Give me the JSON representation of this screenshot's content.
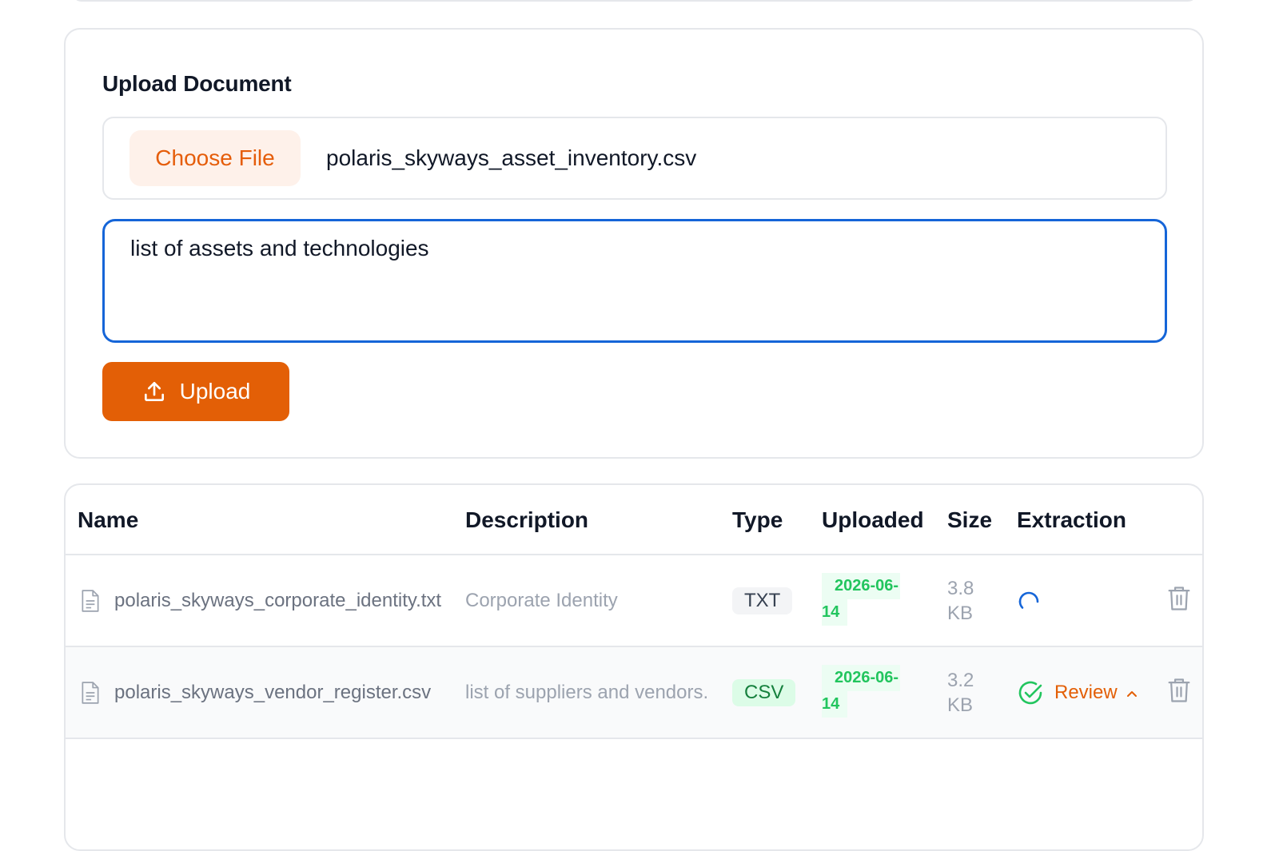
{
  "upload": {
    "title": "Upload Document",
    "choose_file_label": "Choose File",
    "selected_file": "polaris_skyways_asset_inventory.csv",
    "description_value": "list of assets and technologies",
    "upload_label": "Upload"
  },
  "table": {
    "headers": {
      "name": "Name",
      "description": "Description",
      "type": "Type",
      "uploaded": "Uploaded",
      "size": "Size",
      "extraction": "Extraction"
    },
    "rows": [
      {
        "name": "polaris_skyways_corporate_identity.txt",
        "description": "Corporate Identity",
        "type": "TXT",
        "uploaded_line1": "2026-06-",
        "uploaded_line2": "14",
        "size_line1": "3.8",
        "size_line2": "KB",
        "extraction_status": "processing"
      },
      {
        "name": "polaris_skyways_vendor_register.csv",
        "description": "list of suppliers and vendors.",
        "type": "CSV",
        "uploaded_line1": "2026-06-",
        "uploaded_line2": "14",
        "size_line1": "3.2",
        "size_line2": "KB",
        "extraction_status": "complete",
        "extraction_label": "Review"
      }
    ]
  },
  "colors": {
    "accent": "#e35f06",
    "focus": "#1565d8",
    "success": "#22c55e"
  }
}
